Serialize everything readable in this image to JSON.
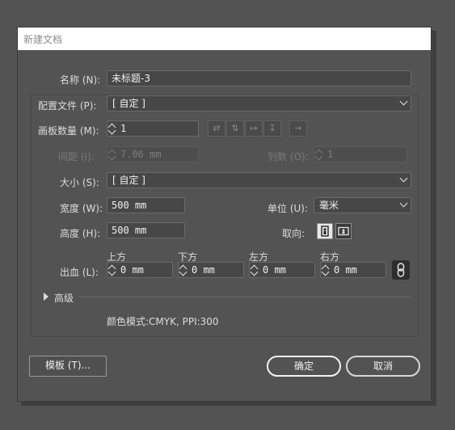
{
  "dialog": {
    "title": "新建文档"
  },
  "name": {
    "label": "名称 (N):",
    "value": "未标题-3"
  },
  "profile": {
    "label": "配置文件 (P):",
    "value": "[ 自定 ]"
  },
  "artboards": {
    "label": "画板数量 (M):",
    "value": "1"
  },
  "spacing": {
    "label": "间距 (I):",
    "value": "7.06 mm"
  },
  "columns": {
    "label": "列数 (O):",
    "value": "1"
  },
  "size": {
    "label": "大小 (S):",
    "value": "[ 自定 ]"
  },
  "width": {
    "label": "宽度 (W):",
    "value": "500 mm"
  },
  "units": {
    "label": "单位 (U):",
    "value": "毫米"
  },
  "height": {
    "label": "高度 (H):",
    "value": "500 mm"
  },
  "orientation": {
    "label": "取向:",
    "selected": "portrait"
  },
  "bleed": {
    "label": "出血 (L):",
    "top_label": "上方",
    "top_value": "0 mm",
    "bottom_label": "下方",
    "bottom_value": "0 mm",
    "left_label": "左方",
    "left_value": "0 mm",
    "right_label": "右方",
    "right_value": "0 mm"
  },
  "advanced": {
    "label": "高级"
  },
  "info": {
    "text": "颜色模式:CMYK, PPI:300"
  },
  "buttons": {
    "templates": "模板 (T)...",
    "ok": "确定",
    "cancel": "取消"
  }
}
